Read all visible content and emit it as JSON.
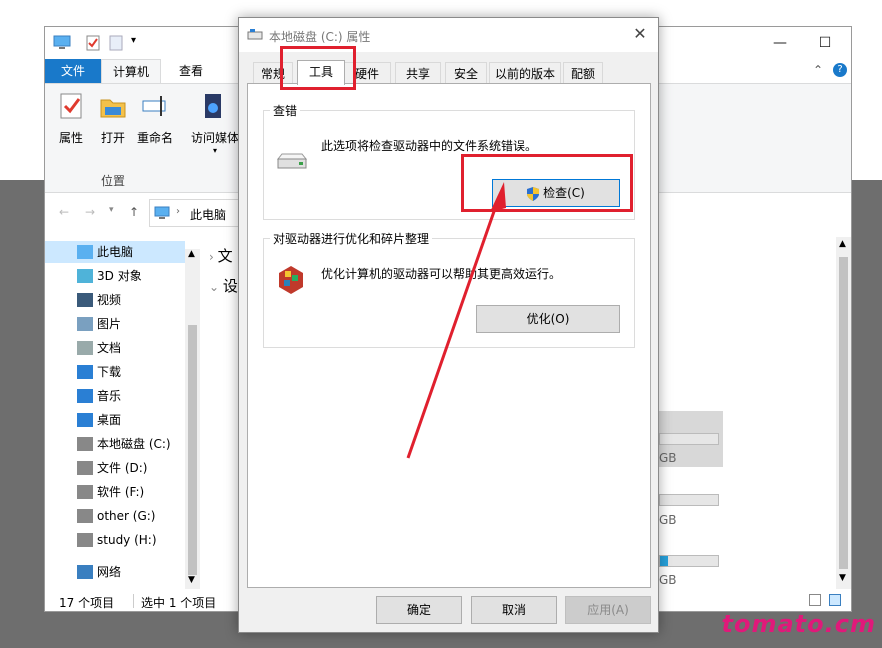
{
  "explorer": {
    "ribbon_tabs": {
      "file": "文件",
      "computer": "计算机",
      "view": "查看"
    },
    "ribbon_buttons": [
      {
        "label": "属性",
        "icon": "properties-icon"
      },
      {
        "label": "打开",
        "icon": "open-folder-icon"
      },
      {
        "label": "重命名",
        "icon": "rename-icon"
      },
      {
        "label": "访问媒体",
        "icon": "access-media-icon"
      }
    ],
    "group_label": "位置",
    "address": "此电脑",
    "tree": [
      {
        "label": "此电脑",
        "icon": "this-pc-icon",
        "selected": true
      },
      {
        "label": "3D 对象",
        "icon": "3d-objects-icon"
      },
      {
        "label": "视频",
        "icon": "videos-icon"
      },
      {
        "label": "图片",
        "icon": "pictures-icon"
      },
      {
        "label": "文档",
        "icon": "documents-icon"
      },
      {
        "label": "下载",
        "icon": "downloads-icon"
      },
      {
        "label": "音乐",
        "icon": "music-icon"
      },
      {
        "label": "桌面",
        "icon": "desktop-icon"
      },
      {
        "label": "本地磁盘 (C:)",
        "icon": "local-disk-icon"
      },
      {
        "label": "文件 (D:)",
        "icon": "drive-icon"
      },
      {
        "label": "软件 (F:)",
        "icon": "drive-icon"
      },
      {
        "label": "other (G:)",
        "icon": "drive-icon"
      },
      {
        "label": "study (H:)",
        "icon": "drive-icon"
      },
      {
        "label": "网络",
        "icon": "network-icon"
      }
    ],
    "section_labels": [
      "文",
      "设"
    ],
    "drive_fragments": [
      "GB",
      "GB",
      "GB"
    ],
    "status_count": "17 个项目",
    "status_selected": "选中 1 个项目"
  },
  "dialog": {
    "title": "本地磁盘 (C:) 属性",
    "tabs": [
      "常规",
      "工具",
      "硬件",
      "共享",
      "安全",
      "以前的版本",
      "配额"
    ],
    "active_tab": 1,
    "error_check": {
      "label": "查错",
      "text": "此选项将检查驱动器中的文件系统错误。",
      "button": "检查(C)"
    },
    "optimize": {
      "label": "对驱动器进行优化和碎片整理",
      "text": "优化计算机的驱动器可以帮助其更高效运行。",
      "button": "优化(O)"
    },
    "ok": "确定",
    "cancel": "取消",
    "apply": "应用(A)"
  },
  "watermark": "tomato.cm",
  "colors": {
    "accent": "#1979ca",
    "highlight": "#e0202e",
    "selection": "#cce8ff"
  }
}
